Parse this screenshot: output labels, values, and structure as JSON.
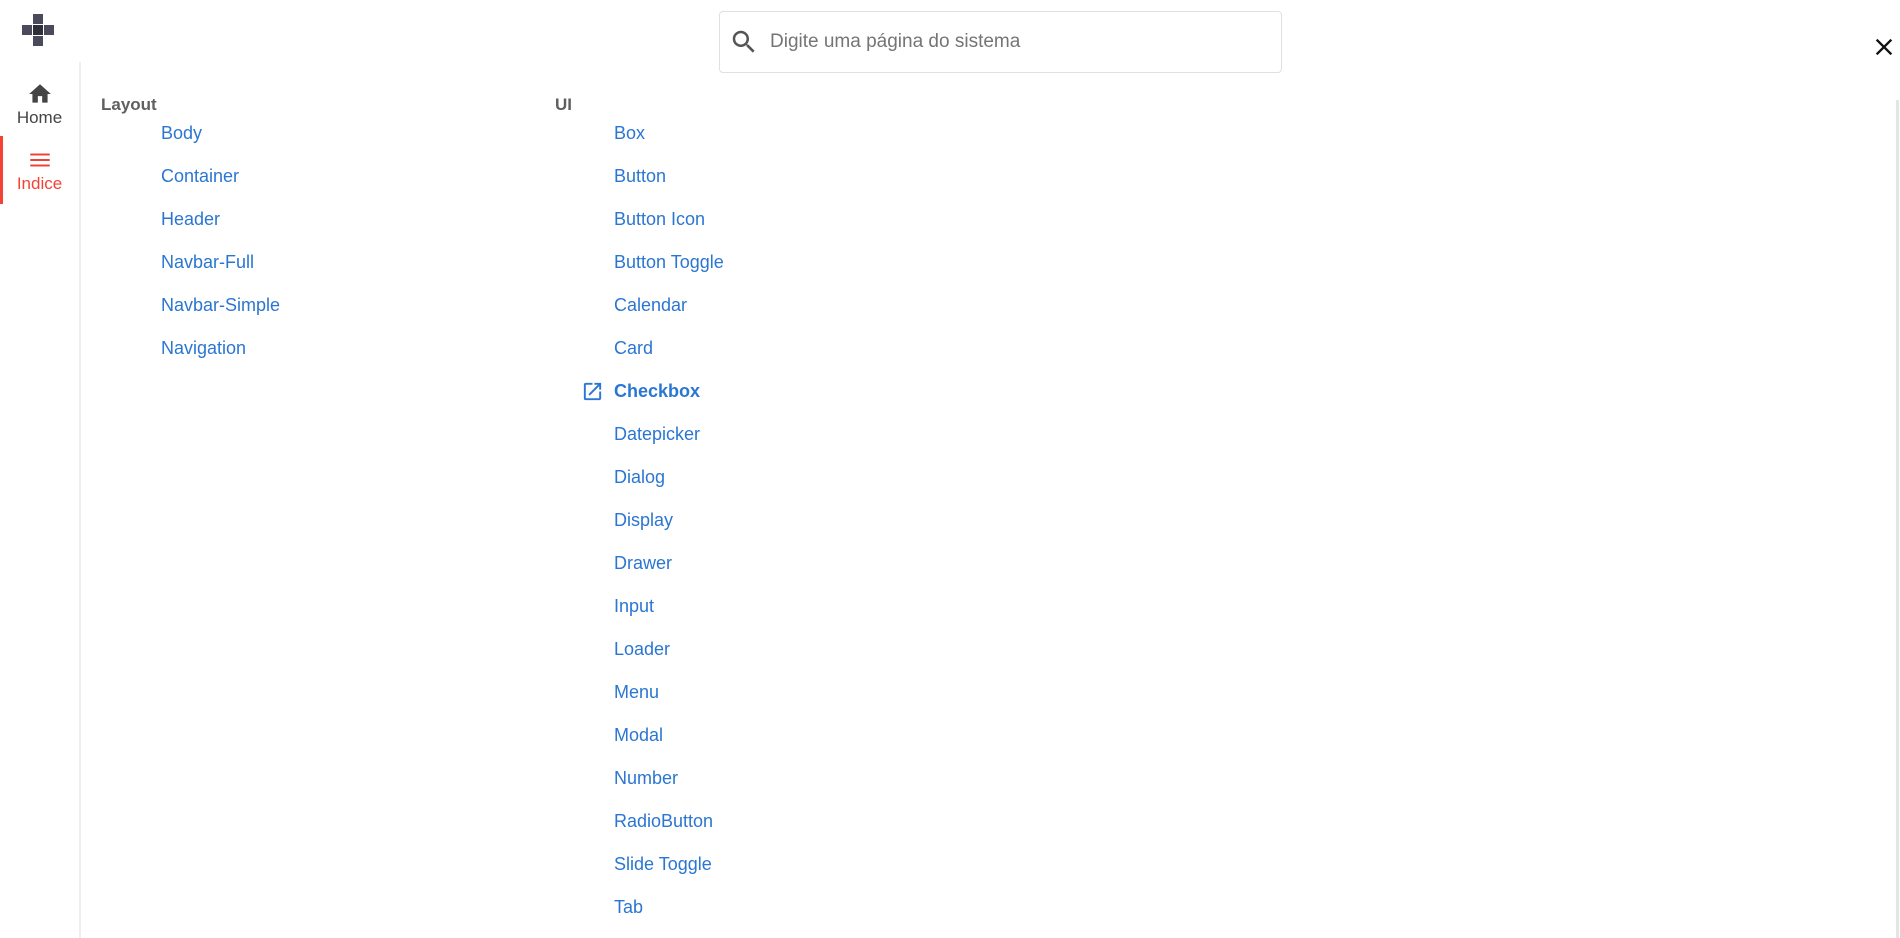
{
  "search": {
    "placeholder": "Digite uma página do sistema"
  },
  "rail": {
    "items": [
      {
        "label": "Home",
        "icon": "home-icon",
        "active": false
      },
      {
        "label": "Indice",
        "icon": "menu-icon",
        "active": true
      }
    ]
  },
  "groups": [
    {
      "title": "Layout",
      "items": [
        {
          "label": "Body"
        },
        {
          "label": "Container"
        },
        {
          "label": "Header"
        },
        {
          "label": "Navbar-Full"
        },
        {
          "label": "Navbar-Simple"
        },
        {
          "label": "Navigation"
        }
      ]
    },
    {
      "title": "UI",
      "items": [
        {
          "label": "Box"
        },
        {
          "label": "Button"
        },
        {
          "label": "Button Icon"
        },
        {
          "label": "Button Toggle"
        },
        {
          "label": "Calendar"
        },
        {
          "label": "Card"
        },
        {
          "label": "Checkbox",
          "active": true,
          "icon": "open-in-new-icon"
        },
        {
          "label": "Datepicker"
        },
        {
          "label": "Dialog"
        },
        {
          "label": "Display"
        },
        {
          "label": "Drawer"
        },
        {
          "label": "Input"
        },
        {
          "label": "Loader"
        },
        {
          "label": "Menu"
        },
        {
          "label": "Modal"
        },
        {
          "label": "Number"
        },
        {
          "label": "RadioButton"
        },
        {
          "label": "Slide Toggle"
        },
        {
          "label": "Tab"
        }
      ]
    }
  ],
  "colors": {
    "link": "#2a76d2",
    "accent": "#f44336",
    "heading": "#5f5f5f",
    "rail_text": "#444444"
  },
  "icons": {
    "logo": "app-logo-icon",
    "search": "search-icon",
    "close": "close-icon"
  }
}
